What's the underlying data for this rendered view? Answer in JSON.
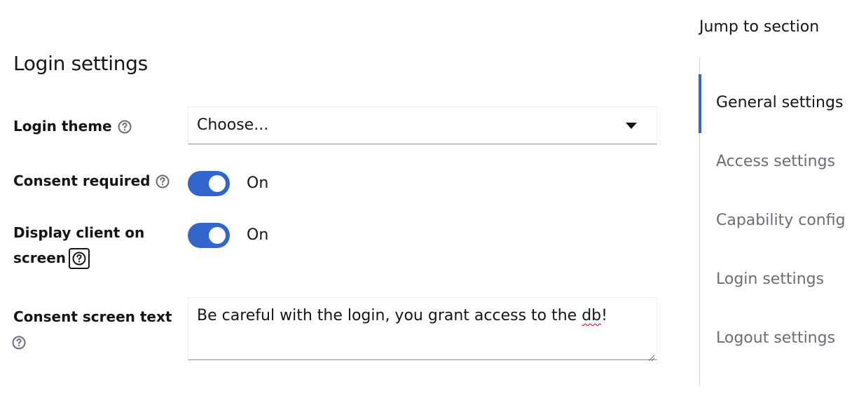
{
  "section": {
    "title": "Login settings"
  },
  "fields": {
    "login_theme": {
      "label": "Login theme",
      "value": "Choose..."
    },
    "consent_required": {
      "label": "Consent required",
      "state": "On"
    },
    "display_client": {
      "label_line1": "Display client on",
      "label_line2": "screen",
      "state": "On"
    },
    "consent_text": {
      "label": "Consent screen text",
      "value_before": "Be careful with the login, you grant access to the ",
      "value_misspelled": "db",
      "value_after": "!"
    }
  },
  "jump": {
    "title": "Jump to section",
    "items": [
      {
        "label": "General settings",
        "active": true
      },
      {
        "label": "Access settings",
        "active": false
      },
      {
        "label": "Capability config",
        "active": false
      },
      {
        "label": "Login settings",
        "active": false
      },
      {
        "label": "Logout settings",
        "active": false
      }
    ]
  },
  "colors": {
    "accent": "#3366cc",
    "text": "#151515",
    "muted": "#6a6e73",
    "border": "#8a8d90"
  },
  "icons": {
    "help": "help-circle-icon",
    "dropdown": "caret-down-icon",
    "resize": "resize-handle-icon"
  }
}
